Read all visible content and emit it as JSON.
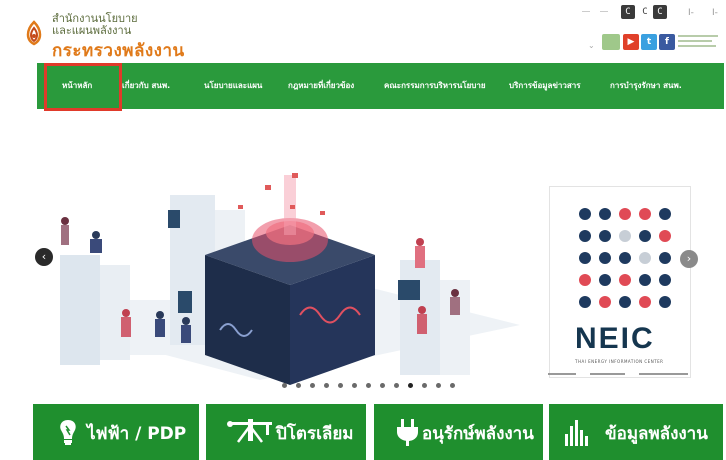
{
  "header": {
    "org_line1": "สำนักงานนโยบาย",
    "org_line2": "และแผนพลังงาน",
    "ministry": "กระทรวงพลังงาน",
    "font_size_buttons": [
      "C",
      "C",
      "C"
    ],
    "social": [
      "youtube-icon",
      "twitter-icon",
      "facebook-icon"
    ]
  },
  "nav": {
    "items": [
      "หน้าหลัก",
      "เกี่ยวกับ สนพ.",
      "นโยบายและแผน",
      "กฎหมายที่เกี่ยวข้อง",
      "คณะกรรมการบริหารนโยบาย",
      "บริการข้อมูลข่าวสาร",
      "การบำรุงรักษา สนพ."
    ],
    "active_index": 0,
    "colors": {
      "bar": "#2a9a3c",
      "highlight": "#e03a2a"
    }
  },
  "slider": {
    "dots_total": 13,
    "active_dot": 9,
    "neic": {
      "title": "NEIC",
      "subtitle": "THAI ENERGY INFORMATION CENTER"
    }
  },
  "quick_links": [
    {
      "label": "ไฟฟ้า / PDP",
      "icon": "lightbulb-icon"
    },
    {
      "label": "ปิโตรเลียม",
      "icon": "oil-pump-icon"
    },
    {
      "label": "อนุรักษ์พลังงาน",
      "icon": "plug-icon"
    },
    {
      "label": "ข้อมูลพลังงาน",
      "icon": "bar-chart-icon"
    }
  ]
}
